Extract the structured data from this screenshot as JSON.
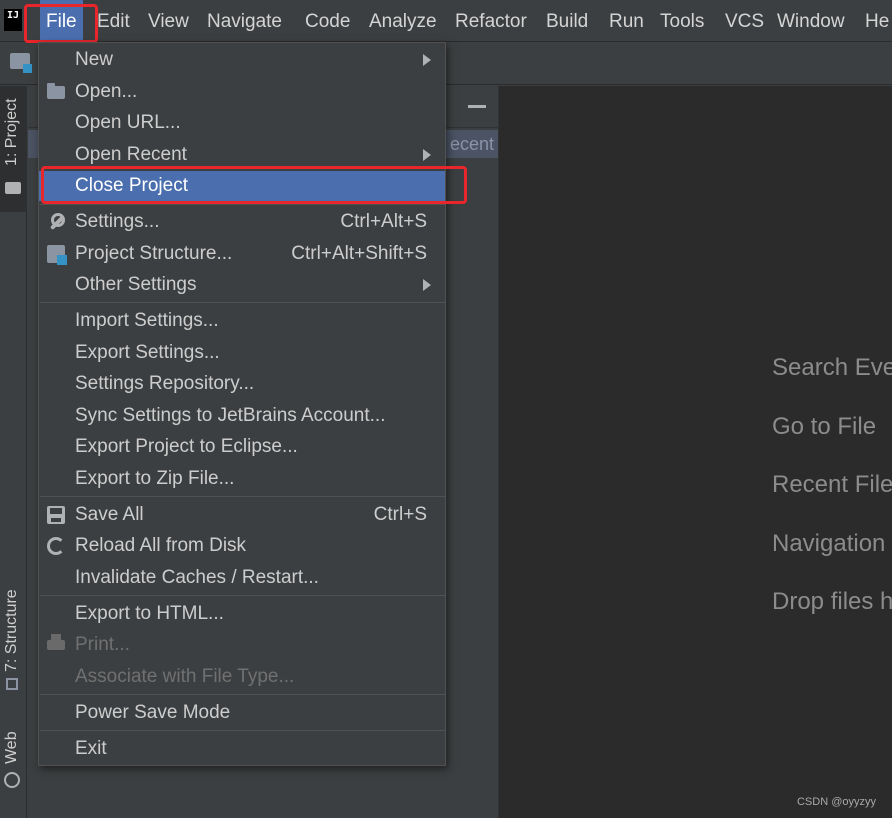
{
  "menubar": {
    "logo_text": "IJ",
    "items": [
      "File",
      "Edit",
      "View",
      "Navigate",
      "Code",
      "Analyze",
      "Refactor",
      "Build",
      "Run",
      "Tools",
      "VCS",
      "Window",
      "He"
    ]
  },
  "left_strip": {
    "project_tab": "1: Project",
    "structure_tab": "7: Structure",
    "web_tab": "Web"
  },
  "project_panel": {
    "recent_fragment": "ecent"
  },
  "file_menu": {
    "new": "New",
    "open": "Open...",
    "open_url": "Open URL...",
    "open_recent": "Open Recent",
    "close_project": "Close Project",
    "settings": "Settings...",
    "settings_shortcut": "Ctrl+Alt+S",
    "project_structure": "Project Structure...",
    "project_structure_shortcut": "Ctrl+Alt+Shift+S",
    "other_settings": "Other Settings",
    "import_settings": "Import Settings...",
    "export_settings": "Export Settings...",
    "settings_repository": "Settings Repository...",
    "sync_settings": "Sync Settings to JetBrains Account...",
    "export_eclipse": "Export Project to Eclipse...",
    "export_zip": "Export to Zip File...",
    "save_all": "Save All",
    "save_all_shortcut": "Ctrl+S",
    "reload_all": "Reload All from Disk",
    "invalidate_caches": "Invalidate Caches / Restart...",
    "export_html": "Export to HTML...",
    "print": "Print...",
    "associate_file_type": "Associate with File Type...",
    "power_save": "Power Save Mode",
    "exit": "Exit"
  },
  "editor": {
    "hints": [
      "Search Eve",
      "Go to File",
      "Recent File",
      "Navigation",
      "Drop files h"
    ],
    "watermark": "CSDN @oyyzyy"
  },
  "colors": {
    "highlight_box": "#e8262b",
    "selection": "#4b6eaf"
  }
}
